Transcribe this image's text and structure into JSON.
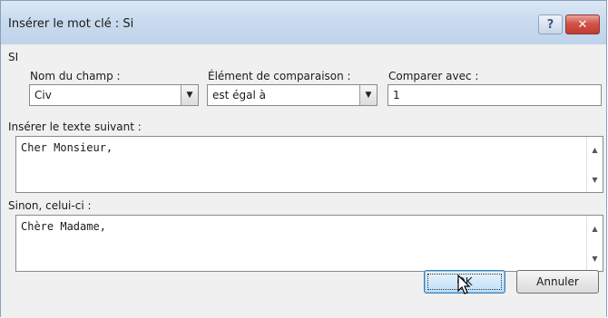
{
  "dialog": {
    "title": "Insérer le mot clé : Si",
    "help_label": "?",
    "close_label": "✕"
  },
  "section": {
    "label": "SI"
  },
  "fields": {
    "field_name": {
      "label": "Nom du champ :",
      "value": "Civ"
    },
    "comparison": {
      "label": "Élément de comparaison :",
      "value": "est égal à"
    },
    "compare_with": {
      "label": "Comparer avec :",
      "value": "1"
    }
  },
  "insert_text": {
    "label": "Insérer le texte suivant :",
    "value": "Cher Monsieur,"
  },
  "otherwise_text": {
    "label": "Sinon, celui-ci :",
    "value": "Chère Madame,"
  },
  "buttons": {
    "ok_label": "OK",
    "cancel_label": "Annuler"
  }
}
